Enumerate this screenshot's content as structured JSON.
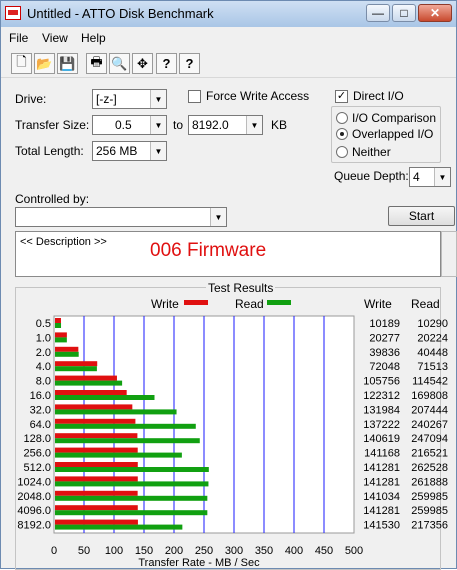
{
  "window": {
    "title": "Untitled - ATTO Disk Benchmark",
    "min_glyph": "—",
    "max_glyph": "□",
    "close_glyph": "✕"
  },
  "menu": [
    "File",
    "View",
    "Help"
  ],
  "toolbar": {
    "icons": [
      "new-icon",
      "open-icon",
      "save-icon",
      "print-icon",
      "print-preview-icon",
      "move-icon",
      "help-icon",
      "context-help-icon"
    ],
    "glyphs": [
      "🗋",
      "📂",
      "💾",
      "🖶",
      "🔍",
      "✥",
      "?",
      "?"
    ]
  },
  "settings": {
    "drive_label": "Drive:",
    "drive_value": "[-z-]",
    "transfer_size_label": "Transfer Size:",
    "transfer_size_from": "0.5",
    "to_label": "to",
    "transfer_size_to": "8192.0",
    "kb_label": "KB",
    "total_length_label": "Total Length:",
    "total_length_value": "256 MB",
    "force_write_label": "Force Write Access",
    "force_write_checked": false,
    "direct_io_label": "Direct I/O",
    "direct_io_checked": true,
    "direct_io_check_glyph": "✓",
    "io_options": [
      {
        "label": "I/O Comparison",
        "selected": false
      },
      {
        "label": "Overlapped I/O",
        "selected": true
      },
      {
        "label": "Neither",
        "selected": false
      }
    ],
    "queue_depth_label": "Queue Depth:",
    "queue_depth_value": "4",
    "controlled_by_label": "Controlled by:",
    "controlled_by_value": "",
    "start_label": "Start",
    "dropdown_arrow": "▼"
  },
  "description": {
    "placeholder": "<< Description >>",
    "text": "006 Firmware",
    "text_color": "#e01010"
  },
  "results": {
    "title": "Test Results",
    "write_label": "Write",
    "read_label": "Read",
    "write_col_header": "Write",
    "read_col_header": "Read",
    "write_color": "#e01010",
    "read_color": "#11a011",
    "grid_color": "#1a1aff"
  },
  "chart_data": {
    "type": "bar",
    "orientation": "horizontal",
    "categories": [
      "0.5",
      "1.0",
      "2.0",
      "4.0",
      "8.0",
      "16.0",
      "32.0",
      "64.0",
      "128.0",
      "256.0",
      "512.0",
      "1024.0",
      "2048.0",
      "4096.0",
      "8192.0"
    ],
    "series": [
      {
        "name": "Write",
        "values": [
          10189,
          20277,
          39836,
          72048,
          105756,
          122312,
          131984,
          137222,
          140619,
          141168,
          141281,
          141281,
          141034,
          141281,
          141530
        ]
      },
      {
        "name": "Read",
        "values": [
          10290,
          20224,
          40448,
          71513,
          114542,
          169808,
          207444,
          240267,
          247094,
          216521,
          262528,
          261888,
          259985,
          259985,
          217356
        ]
      }
    ],
    "xlabel": "Transfer Rate - MB / Sec",
    "xticks": [
      "0",
      "50",
      "100",
      "150",
      "200",
      "250",
      "300",
      "350",
      "400",
      "450",
      "500"
    ],
    "xlim": [
      0,
      500
    ],
    "grid": true
  }
}
